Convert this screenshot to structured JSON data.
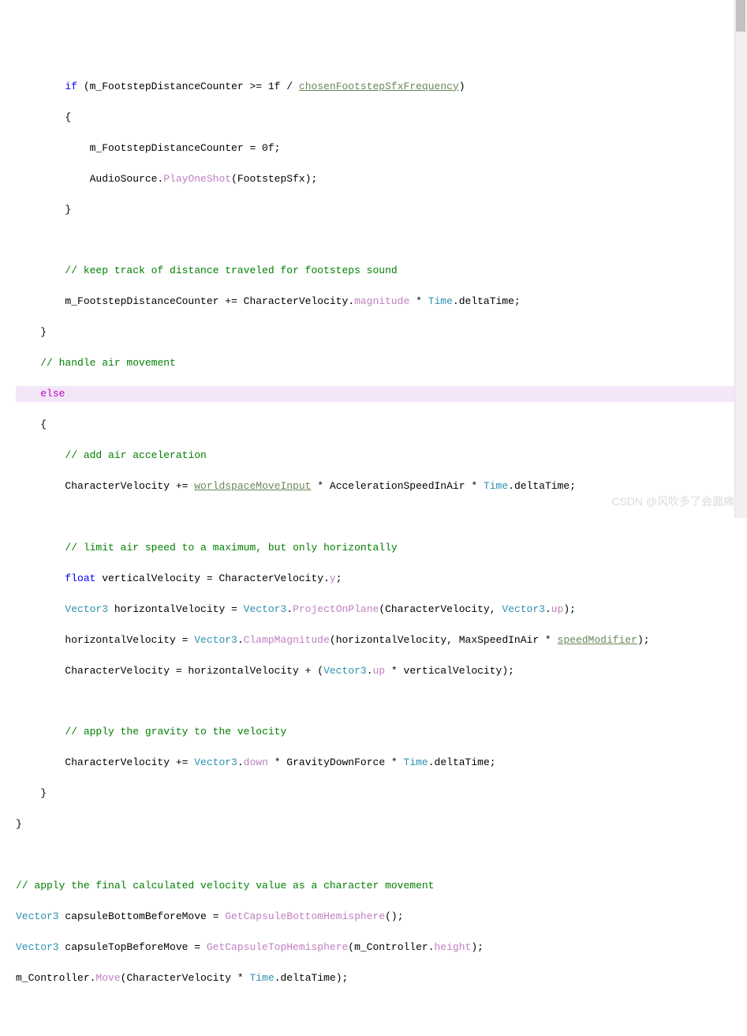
{
  "code": {
    "l1a": "        ",
    "l1_if": "if",
    "l1b": " (m_FootstepDistanceCounter >= 1f / ",
    "l1c": "chosenFootstepSfxFrequency",
    "l1d": ")",
    "l2": "        {",
    "l3": "            m_FootstepDistanceCounter = 0f;",
    "l4a": "            AudioSource.",
    "l4b": "PlayOneShot",
    "l4c": "(FootstepSfx);",
    "l5": "        }",
    "l6": "",
    "l7a": "        ",
    "l7b": "// keep track of distance traveled for footsteps sound",
    "l8a": "        m_FootstepDistanceCounter += CharacterVelocity.",
    "l8b": "magnitude",
    "l8c": " * ",
    "l8d": "Time",
    "l8e": ".deltaTime;",
    "l9": "    }",
    "l10a": "    ",
    "l10b": "// handle air movement",
    "l11a": "    ",
    "l11b": "else",
    "l12": "    {",
    "l13a": "        ",
    "l13b": "// add air acceleration",
    "l14a": "        CharacterVelocity += ",
    "l14b": "worldspaceMoveInput",
    "l14c": " * AccelerationSpeedInAir * ",
    "l14d": "Time",
    "l14e": ".deltaTime;",
    "l15": "",
    "l16a": "        ",
    "l16b": "// limit air speed to a maximum, but only horizontally",
    "l17a": "        ",
    "l17b": "float",
    "l17c": " verticalVelocity = CharacterVelocity.",
    "l17d": "y",
    "l17e": ";",
    "l18a": "        ",
    "l18b": "Vector3",
    "l18c": " horizontalVelocity = ",
    "l18d": "Vector3",
    "l18e": ".",
    "l18f": "ProjectOnPlane",
    "l18g": "(CharacterVelocity, ",
    "l18h": "Vector3",
    "l18i": ".",
    "l18j": "up",
    "l18k": ");",
    "l19a": "        horizontalVelocity = ",
    "l19b": "Vector3",
    "l19c": ".",
    "l19d": "ClampMagnitude",
    "l19e": "(horizontalVelocity, MaxSpeedInAir * ",
    "l19f": "speedModifier",
    "l19g": ");",
    "l20a": "        CharacterVelocity = horizontalVelocity + (",
    "l20b": "Vector3",
    "l20c": ".",
    "l20d": "up",
    "l20e": " * verticalVelocity);",
    "l21": "",
    "l22a": "        ",
    "l22b": "// apply the gravity to the velocity",
    "l23a": "        CharacterVelocity += ",
    "l23b": "Vector3",
    "l23c": ".",
    "l23d": "down",
    "l23e": " * GravityDownForce * ",
    "l23f": "Time",
    "l23g": ".deltaTime;",
    "l24": "    }",
    "l25": "}",
    "l26": "",
    "l27": "// apply the final calculated velocity value as a character movement",
    "l28a": "Vector3",
    "l28b": " capsuleBottomBeforeMove = ",
    "l28c": "GetCapsuleBottomHemisphere",
    "l28d": "();",
    "l29a": "Vector3",
    "l29b": " capsuleTopBeforeMove = ",
    "l29c": "GetCapsuleTopHemisphere",
    "l29d": "(m_Controller.",
    "l29e": "height",
    "l29f": ");",
    "l30a": "m_Controller.",
    "l30b": "Move",
    "l30c": "(CharacterVelocity * ",
    "l30d": "Time",
    "l30e": ".deltaTime);"
  },
  "watermark": "CSDN @风吹多了会面瘫"
}
